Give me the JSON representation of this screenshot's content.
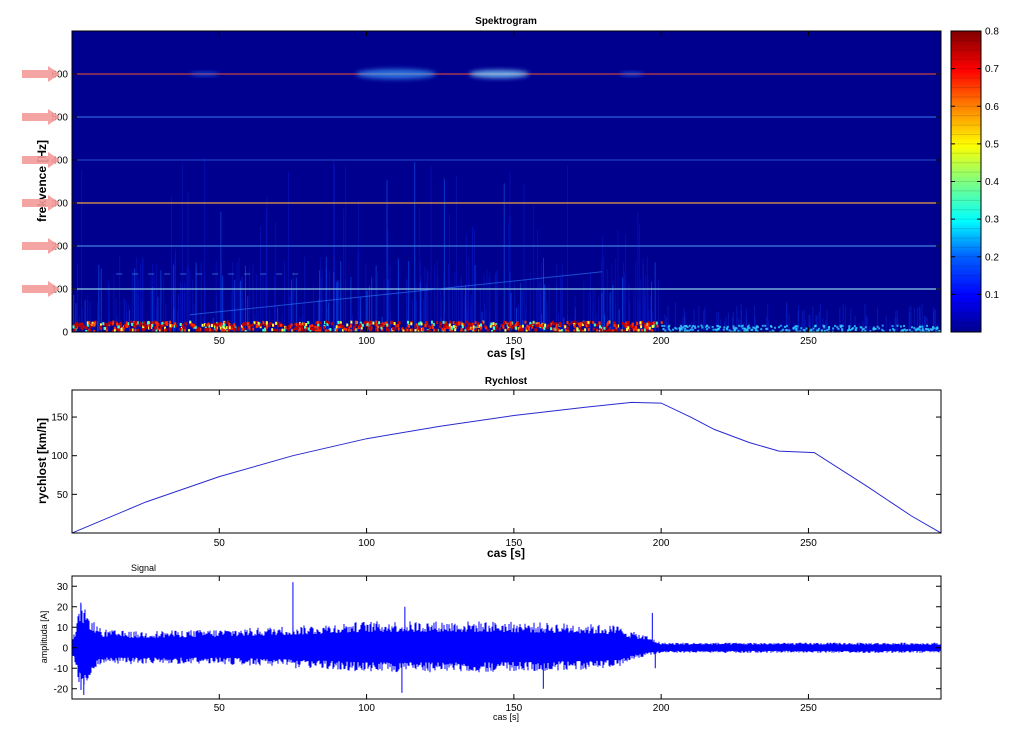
{
  "chart_data": [
    {
      "type": "heatmap",
      "title": "Spektrogram",
      "xlabel": "cas [s]",
      "ylabel": "frekvence [Hz]",
      "xlim": [
        0,
        295
      ],
      "ylim": [
        0,
        700
      ],
      "xticks": [
        50,
        100,
        150,
        200,
        250
      ],
      "yticks": [
        0,
        100,
        200,
        300,
        400,
        500,
        600
      ],
      "colorbar": {
        "range": [
          0,
          0.8
        ],
        "ticks": [
          0.1,
          0.2,
          0.3,
          0.4,
          0.5,
          0.6,
          0.7,
          0.8
        ]
      },
      "harmonic_lines_hz": [
        {
          "freq": 100,
          "color": "#8fd0e6",
          "x_range": [
            0,
            295
          ]
        },
        {
          "freq": 200,
          "color": "#3f7fe0",
          "x_range": [
            0,
            295
          ]
        },
        {
          "freq": 300,
          "color": "#f0a040",
          "x_range": [
            0,
            295
          ]
        },
        {
          "freq": 400,
          "color": "#1c3fbf",
          "x_range": [
            0,
            295
          ]
        },
        {
          "freq": 500,
          "color": "#2f5fe0",
          "x_range": [
            0,
            295
          ]
        },
        {
          "freq": 600,
          "color": "#c84040",
          "x_range": [
            0,
            295
          ]
        }
      ],
      "arrow_markers_hz": [
        100,
        200,
        300,
        400,
        500,
        600
      ]
    },
    {
      "type": "line",
      "title": "Rychlost",
      "xlabel": "cas [s]",
      "ylabel": "rychlost [km/h]",
      "xlim": [
        0,
        295
      ],
      "ylim": [
        0,
        185
      ],
      "xticks": [
        50,
        100,
        150,
        200,
        250
      ],
      "yticks": [
        50,
        100,
        150
      ],
      "series": [
        {
          "color": "#2a2ad0",
          "x": [
            0,
            25,
            50,
            75,
            100,
            125,
            150,
            175,
            190,
            200,
            210,
            218,
            230,
            240,
            252,
            270,
            285,
            295
          ],
          "y": [
            0,
            40,
            73,
            100,
            122,
            138,
            152,
            163,
            169,
            168,
            150,
            134,
            117,
            106,
            104,
            60,
            22,
            0
          ]
        }
      ]
    },
    {
      "type": "line",
      "title": "Signal",
      "xlabel": "cas [s]",
      "ylabel": "amplituda [A]",
      "xlim": [
        0,
        295
      ],
      "ylim": [
        -25,
        35
      ],
      "xticks": [
        50,
        100,
        150,
        200,
        250
      ],
      "yticks": [
        -20,
        -10,
        0,
        10,
        20,
        30
      ],
      "series": [
        {
          "color": "#0000ff",
          "envelope": {
            "x": [
              0,
              3,
              6,
              10,
              20,
              50,
              80,
              100,
              140,
              170,
              185,
              190,
              195,
              200,
              230,
              260,
              295
            ],
            "upper": [
              2,
              22,
              15,
              9,
              8,
              9,
              11,
              13,
              13,
              12,
              11,
              8,
              6,
              2.5,
              2.5,
              2.5,
              2.5
            ],
            "lower": [
              -2,
              -22,
              -14,
              -8,
              -8,
              -8,
              -10,
              -12,
              -12,
              -11,
              -10,
              -6,
              -4,
              -2.5,
              -2.5,
              -2.5,
              -2.5
            ]
          },
          "spikes": [
            {
              "x": 3,
              "y": 22
            },
            {
              "x": 4,
              "y": -23
            },
            {
              "x": 75,
              "y": 32
            },
            {
              "x": 76,
              "y": -10
            },
            {
              "x": 113,
              "y": 20
            },
            {
              "x": 112,
              "y": -22
            },
            {
              "x": 160,
              "y": -20
            },
            {
              "x": 197,
              "y": 17
            },
            {
              "x": 198,
              "y": -10
            }
          ]
        }
      ]
    }
  ]
}
